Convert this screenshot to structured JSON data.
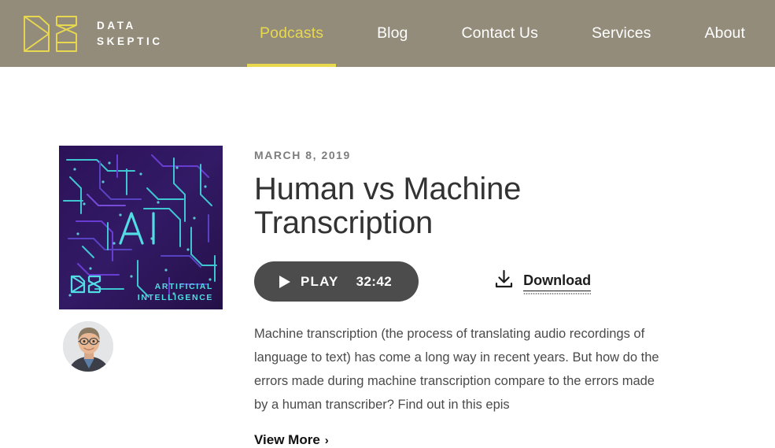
{
  "header": {
    "brand": {
      "logo_icon": "ds-monogram-logo",
      "line1": "DATA",
      "line2": "SKEPTIC",
      "logo_color": "#e8d84f"
    },
    "background_color": "#938c7a",
    "nav": [
      {
        "label": "Podcasts",
        "active": true
      },
      {
        "label": "Blog",
        "active": false
      },
      {
        "label": "Contact Us",
        "active": false
      },
      {
        "label": "Services",
        "active": false
      },
      {
        "label": "About",
        "active": false
      }
    ],
    "active_color": "#e8d84f"
  },
  "episode": {
    "cover": {
      "icon": "ai-circuit-board-cover-art",
      "center_text": "AI",
      "brand_text": "DS",
      "caption_line1": "ARTIFICIAL",
      "caption_line2": "INTELLIGENCE",
      "background_color": "#2a1252",
      "trace_color": "#3fd0d8"
    },
    "avatar": {
      "icon": "host-avatar-photo",
      "alt": "Host portrait"
    },
    "date": "MARCH 8, 2019",
    "title": "Human vs Machine Transcription",
    "play": {
      "icon": "play-triangle-icon",
      "label": "PLAY",
      "duration": "32:42",
      "background_color": "#4c4c4c"
    },
    "download": {
      "icon": "download-arrow-icon",
      "label": "Download"
    },
    "description": "Machine transcription (the process of translating audio recordings of language to text) has come a long way in recent years. But how do the errors made during machine transcription compare to the errors made by a human transcriber? Find out in this epis",
    "view_more": {
      "label": "View More",
      "chevron": "›"
    }
  }
}
